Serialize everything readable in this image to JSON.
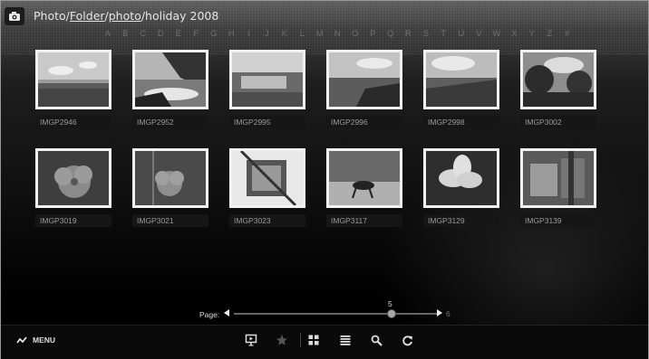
{
  "header": {
    "path": [
      {
        "label": "Photo",
        "link": false
      },
      {
        "label": "/",
        "link": false
      },
      {
        "label": "Folder",
        "link": true
      },
      {
        "label": "/",
        "link": false
      },
      {
        "label": "photo",
        "link": true
      },
      {
        "label": "/",
        "link": false
      },
      {
        "label": "holiday 2008",
        "link": false
      }
    ]
  },
  "alphabet": [
    "A",
    "B",
    "C",
    "D",
    "E",
    "F",
    "G",
    "H",
    "I",
    "J",
    "K",
    "L",
    "M",
    "N",
    "O",
    "P",
    "Q",
    "R",
    "S",
    "T",
    "U",
    "V",
    "W",
    "X",
    "Y",
    "Z",
    "#"
  ],
  "photos": [
    {
      "name": "IMGP2946"
    },
    {
      "name": "IMGP2952"
    },
    {
      "name": "IMGP2995"
    },
    {
      "name": "IMGP2996"
    },
    {
      "name": "IMGP2998"
    },
    {
      "name": "IMGP3002"
    },
    {
      "name": "IMGP3019"
    },
    {
      "name": "IMGP3021"
    },
    {
      "name": "IMGP3023"
    },
    {
      "name": "IMGP3117"
    },
    {
      "name": "IMGP3129"
    },
    {
      "name": "IMGP3139"
    }
  ],
  "pager": {
    "label": "Page:",
    "current": "5",
    "total": "6",
    "progress": 0.8
  },
  "bottombar": {
    "menu_label": "MENU",
    "tools": [
      "slideshow-icon",
      "favorite-icon",
      "grid-view-icon",
      "list-view-icon",
      "search-icon",
      "refresh-icon"
    ]
  }
}
